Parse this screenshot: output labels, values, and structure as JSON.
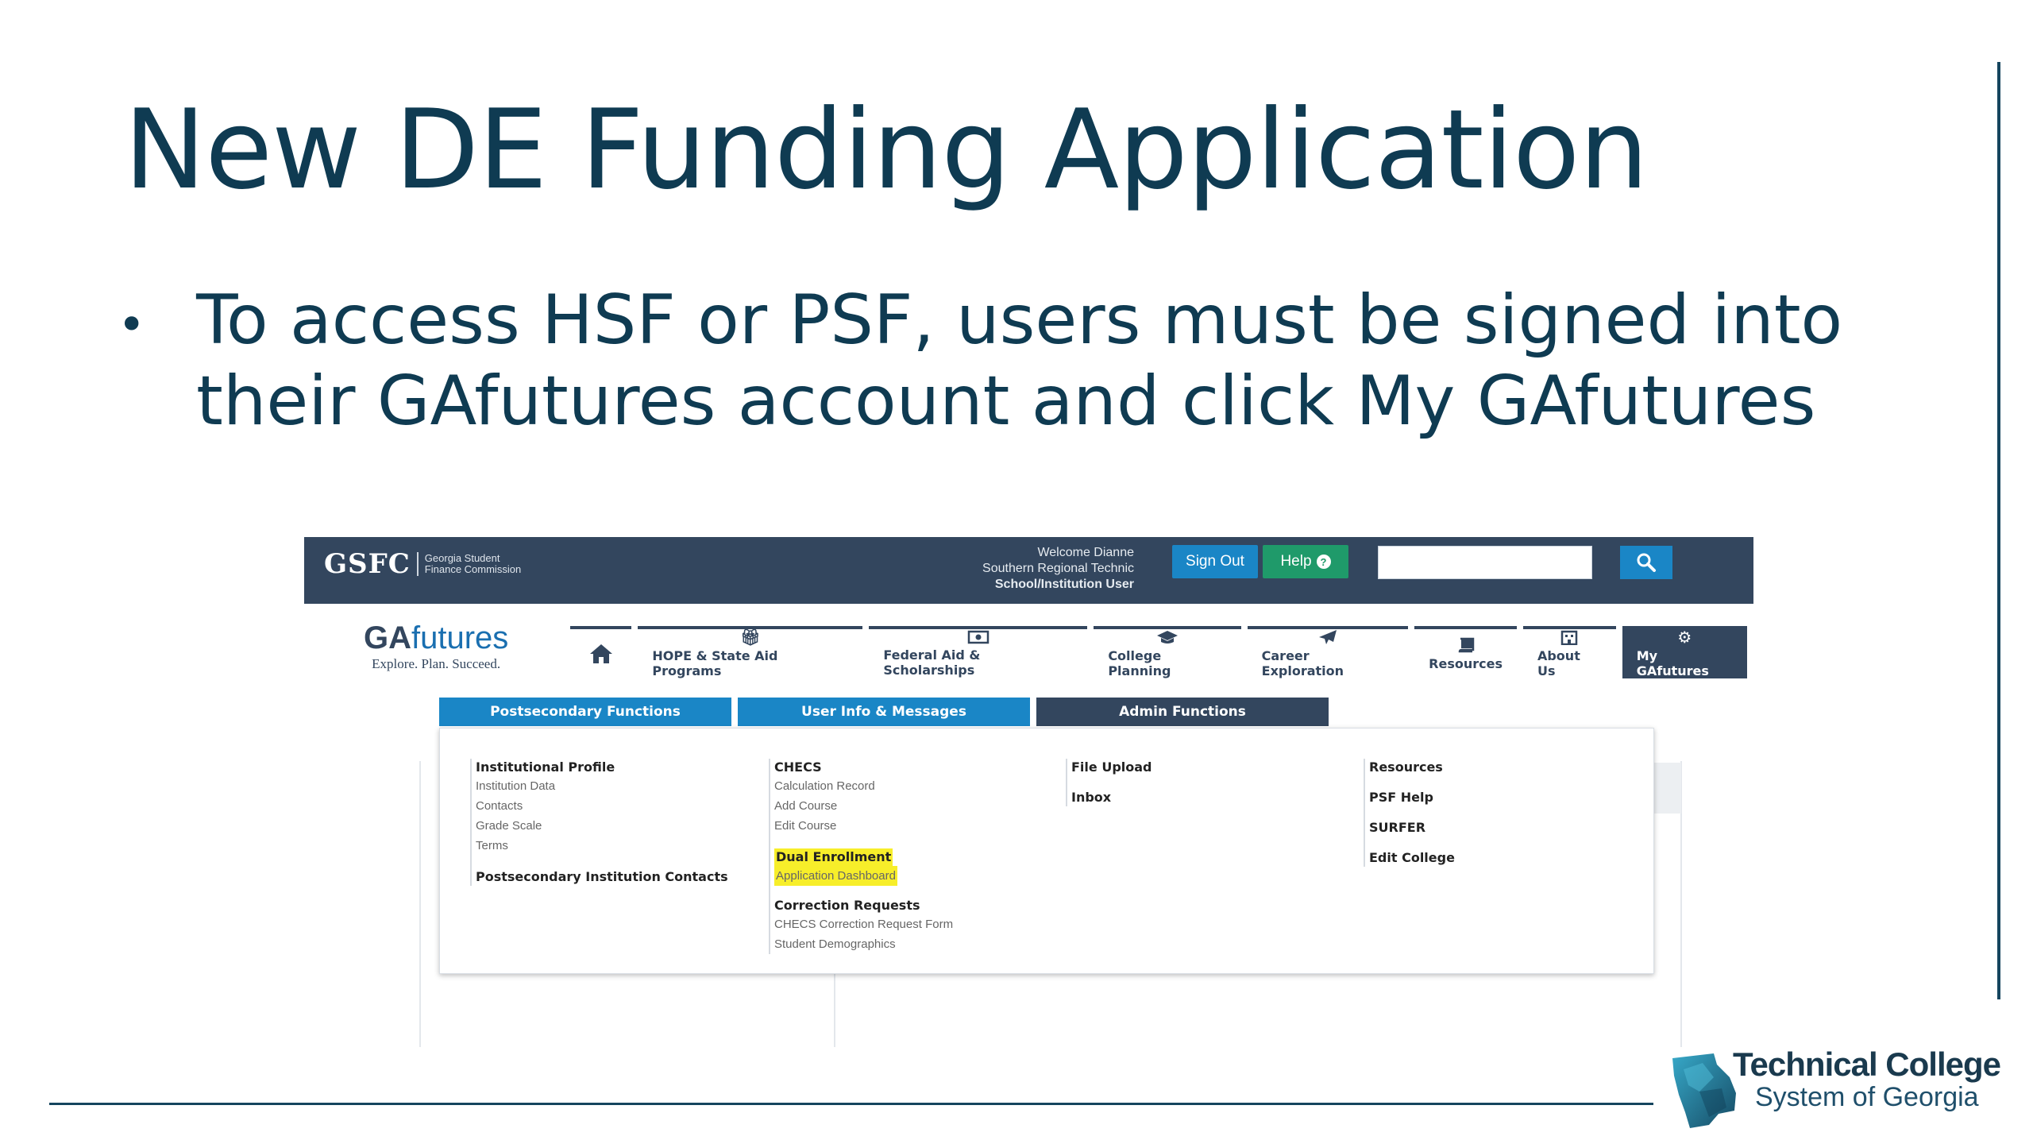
{
  "slide": {
    "title": "New DE Funding Application",
    "bullet": "To access HSF or PSF, users must be signed into their GAfutures account and click My GAfutures"
  },
  "screenshot": {
    "header": {
      "logo_text": "GSFC",
      "logo_sub_1": "Georgia Student",
      "logo_sub_2": "Finance Commission",
      "welcome_line_1": "Welcome Dianne",
      "welcome_line_2": "Southern Regional Technic",
      "welcome_line_3": "School/Institution User",
      "sign_out_label": "Sign Out",
      "help_label": "Help",
      "search_placeholder": ""
    },
    "brand": {
      "ga": "GA",
      "futures": "futures",
      "tagline": "Explore. Plan. Succeed."
    },
    "nav": [
      {
        "label": "",
        "icon": "home-icon"
      },
      {
        "label": "HOPE & State Aid Programs",
        "icon": "gift-icon"
      },
      {
        "label": "Federal Aid & Scholarships",
        "icon": "money-icon"
      },
      {
        "label": "College Planning",
        "icon": "graduation-cap-icon"
      },
      {
        "label": "Career Exploration",
        "icon": "paper-plane-icon"
      },
      {
        "label": "Resources",
        "icon": "book-icon"
      },
      {
        "label": "About Us",
        "icon": "building-icon"
      },
      {
        "label": "My GAfutures",
        "icon": "gear-icon"
      }
    ],
    "subtabs": [
      {
        "label": "Postsecondary Functions"
      },
      {
        "label": "User Info & Messages"
      },
      {
        "label": "Admin Functions"
      }
    ],
    "menu": {
      "col1": {
        "institutional_profile": "Institutional Profile",
        "links": [
          "Institution Data",
          "Contacts",
          "Grade Scale",
          "Terms"
        ],
        "contacts_head": "Postsecondary Institution Contacts"
      },
      "col2": {
        "checcs_head": "CHECS",
        "checcs_links": [
          "Calculation Record",
          "Add Course",
          "Edit Course"
        ],
        "de_head": "Dual Enrollment",
        "de_link": "Application Dashboard",
        "corr_head": "Correction Requests",
        "corr_links": [
          "CHECS Correction Request Form",
          "Student Demographics"
        ]
      },
      "col3": {
        "items": [
          "File Upload",
          "Inbox"
        ]
      },
      "col4": {
        "items": [
          "Resources",
          "PSF Help",
          "SURFER",
          "Edit College"
        ]
      }
    },
    "highlight_color": "#f7ee2a"
  },
  "footer_logo": {
    "line1": "Technical College",
    "line2": "System of Georgia"
  }
}
